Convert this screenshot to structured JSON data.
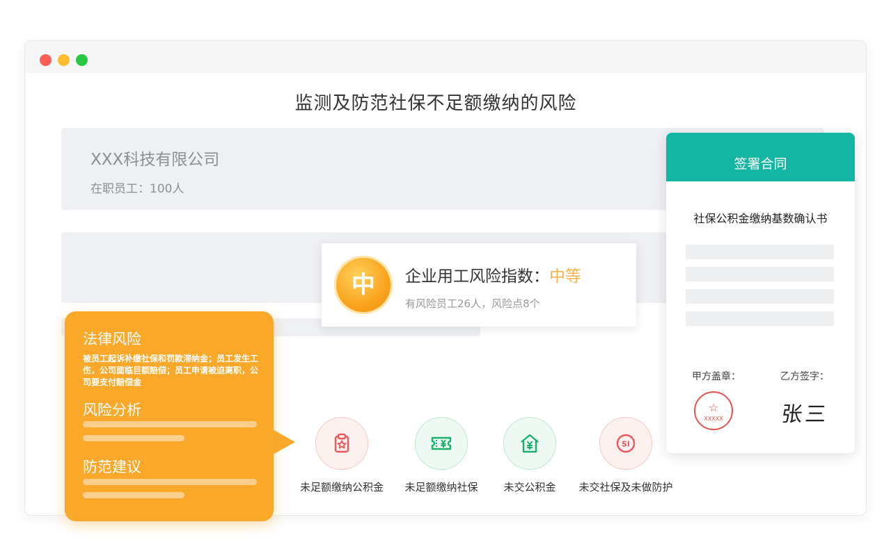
{
  "page_title": "监测及防范社保不足额缴纳的风险",
  "company": {
    "name": "XXX科技有限公司",
    "staff": "在职员工：100人"
  },
  "risk_index": {
    "badge": "中",
    "label": "企业用工风险指数：",
    "level": "中等",
    "subtitle": "有风险员工26人，风险点8个",
    "level_color": "#f9b34a"
  },
  "legal_panel": {
    "title_legal": "法律风险",
    "legal_desc": "被员工起诉补缴社保和罚款滞纳金；员工发生工伤，公司面临巨额赔偿；员工申请被迫离职，公司要支付赔偿金",
    "title_analysis": "风险分析",
    "title_prevention": "防范建议",
    "color": "#f9a82a"
  },
  "risk_items": [
    {
      "label": "未足额缴纳公积金",
      "icon": "clipboard-star-icon",
      "color": "#f0575a"
    },
    {
      "label": "未足额缴纳社保",
      "icon": "ticket-yen-icon",
      "color": "#17b26a"
    },
    {
      "label": "未交公积金",
      "icon": "house-yen-icon",
      "color": "#17b26a"
    },
    {
      "label": "未交社保及未做防护",
      "icon": "si-badge-icon",
      "color": "#f0575a"
    }
  ],
  "contract": {
    "header": "签署合同",
    "doc_title": "社保公积金缴纳基数确认书",
    "party_a": "甲方盖章：",
    "party_b": "乙方签字：",
    "seal_text": "XXXXX",
    "signature": "张三",
    "accent": "#13b6a2"
  }
}
